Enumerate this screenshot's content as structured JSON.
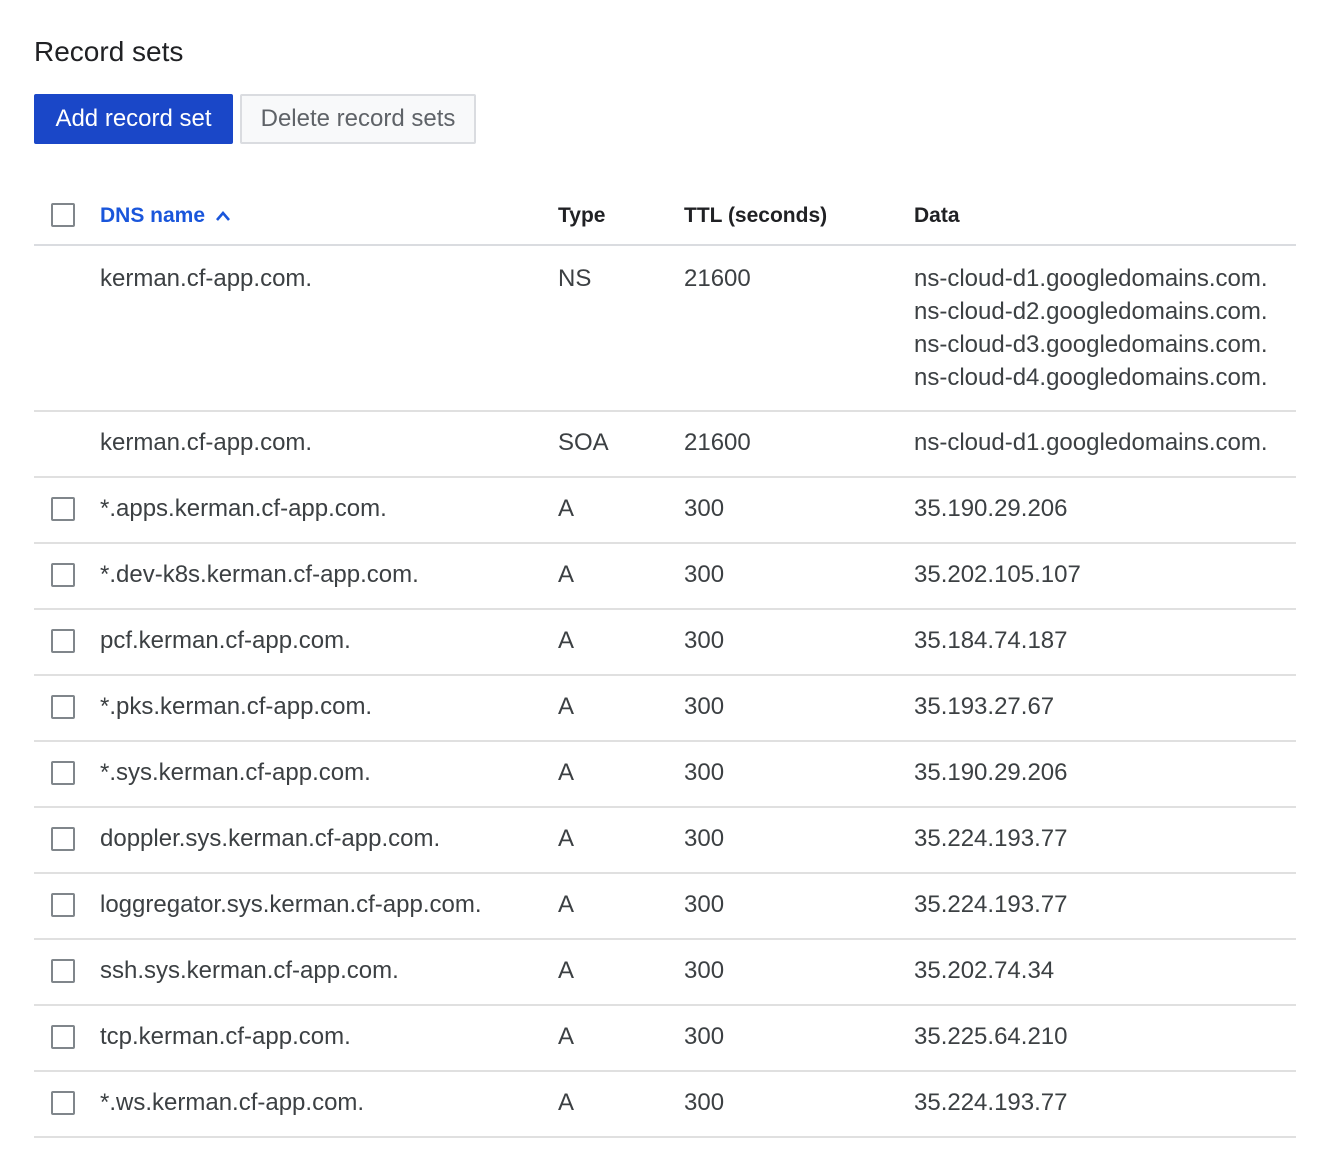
{
  "page": {
    "title": "Record sets"
  },
  "toolbar": {
    "add_label": "Add record set",
    "delete_label": "Delete record sets"
  },
  "table": {
    "headers": {
      "name": "DNS name",
      "type": "Type",
      "ttl": "TTL (seconds)",
      "data": "Data"
    },
    "sort_icon": "chevron-up-icon",
    "rows": [
      {
        "name": "kerman.cf-app.com.",
        "type": "NS",
        "ttl": "21600",
        "data": [
          "ns-cloud-d1.googledomains.com.",
          "ns-cloud-d2.googledomains.com.",
          "ns-cloud-d3.googledomains.com.",
          "ns-cloud-d4.googledomains.com."
        ]
      },
      {
        "name": "kerman.cf-app.com.",
        "type": "SOA",
        "ttl": "21600",
        "data": [
          "ns-cloud-d1.googledomains.com."
        ]
      },
      {
        "name": "*.apps.kerman.cf-app.com.",
        "type": "A",
        "ttl": "300",
        "data": [
          "35.190.29.206"
        ]
      },
      {
        "name": "*.dev-k8s.kerman.cf-app.com.",
        "type": "A",
        "ttl": "300",
        "data": [
          "35.202.105.107"
        ]
      },
      {
        "name": "pcf.kerman.cf-app.com.",
        "type": "A",
        "ttl": "300",
        "data": [
          "35.184.74.187"
        ]
      },
      {
        "name": "*.pks.kerman.cf-app.com.",
        "type": "A",
        "ttl": "300",
        "data": [
          "35.193.27.67"
        ]
      },
      {
        "name": "*.sys.kerman.cf-app.com.",
        "type": "A",
        "ttl": "300",
        "data": [
          "35.190.29.206"
        ]
      },
      {
        "name": "doppler.sys.kerman.cf-app.com.",
        "type": "A",
        "ttl": "300",
        "data": [
          "35.224.193.77"
        ]
      },
      {
        "name": "loggregator.sys.kerman.cf-app.com.",
        "type": "A",
        "ttl": "300",
        "data": [
          "35.224.193.77"
        ]
      },
      {
        "name": "ssh.sys.kerman.cf-app.com.",
        "type": "A",
        "ttl": "300",
        "data": [
          "35.202.74.34"
        ]
      },
      {
        "name": "tcp.kerman.cf-app.com.",
        "type": "A",
        "ttl": "300",
        "data": [
          "35.225.64.210"
        ]
      },
      {
        "name": "*.ws.kerman.cf-app.com.",
        "type": "A",
        "ttl": "300",
        "data": [
          "35.224.193.77"
        ]
      }
    ]
  }
}
